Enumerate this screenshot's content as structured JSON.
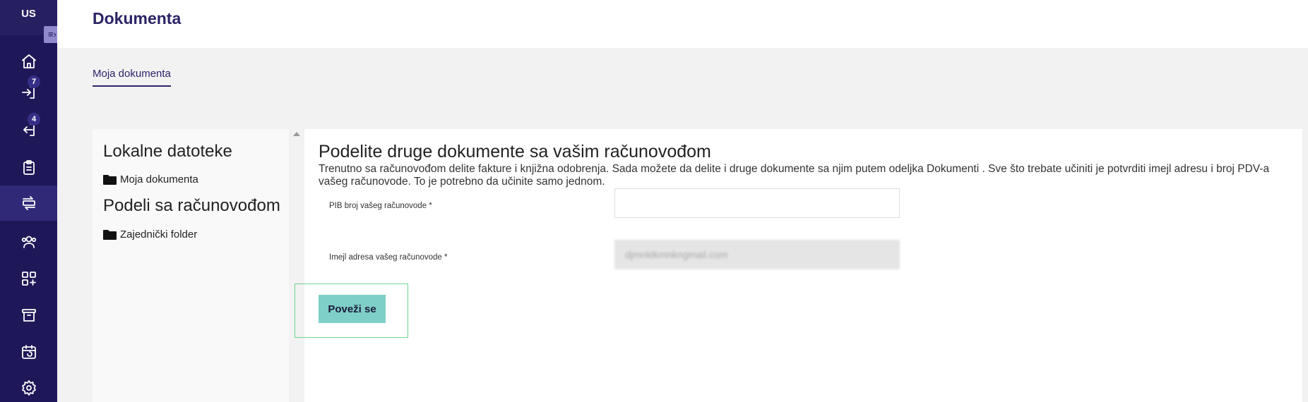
{
  "app": {
    "avatar_initials": "US",
    "collapse_icon": "collapse-sidebar-icon"
  },
  "sidebar": {
    "items": [
      {
        "name": "home",
        "icon": "home-icon"
      },
      {
        "name": "incoming",
        "icon": "login-icon",
        "badge": "7"
      },
      {
        "name": "outgoing",
        "icon": "logout-icon",
        "badge": "4"
      },
      {
        "name": "clipboard",
        "icon": "clipboard-icon"
      },
      {
        "name": "documents",
        "icon": "transfer-icon",
        "active": true
      },
      {
        "name": "contacts",
        "icon": "users-icon"
      },
      {
        "name": "apps",
        "icon": "apps-add-icon"
      },
      {
        "name": "archive",
        "icon": "archive-icon"
      },
      {
        "name": "calendar",
        "icon": "calendar-sync-icon"
      },
      {
        "name": "settings",
        "icon": "gear-icon"
      }
    ]
  },
  "header": {
    "title": "Dokumenta"
  },
  "tabs": [
    {
      "label": "Moja dokumenta",
      "active": true
    }
  ],
  "left_panel": {
    "local_heading": "Lokalne datoteke",
    "local_folder": "Moja dokumenta",
    "share_heading": "Podeli sa računovođom",
    "share_folder": "Zajednički folder"
  },
  "main": {
    "heading": "Podelite druge dokumente sa vašim računovođom",
    "description": "Trenutno sa računovođom delite fakture i knjižna odobrenja. Sada možete da delite i druge dokumente sa njim putem odeljka Dokumenti . Sve što trebate učiniti je potvrditi imejl adresu i broj PDV-a vašeg računovode. To je potrebno da učinite samo jednom.",
    "pib_label": "PIB broj vašeg računovode *",
    "pib_value": "",
    "email_label": "Imejl adresa vašeg računovode *",
    "email_value": "djmnklkmnkngmail.com",
    "connect_label": "Poveži se"
  },
  "colors": {
    "sidebar_bg": "#1f1858",
    "accent": "#2b2467",
    "button": "#7ecfc8",
    "focus_outline": "#6fd48f"
  }
}
